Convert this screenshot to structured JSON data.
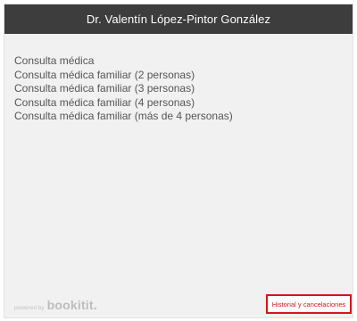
{
  "header": {
    "title": "Dr. Valentín López-Pintor González"
  },
  "services": [
    {
      "label": "Consulta médica"
    },
    {
      "label": "Consulta médica familiar (2 personas)"
    },
    {
      "label": "Consulta médica familiar (3 personas)"
    },
    {
      "label": "Consulta médica familiar (4 personas)"
    },
    {
      "label": "Consulta médica familiar (más de 4 personas)"
    }
  ],
  "footer": {
    "powered_by": "powered by",
    "brand": "bookitit",
    "brand_suffix": ".",
    "history_link": "Historial y cancelaciones"
  },
  "colors": {
    "header_bg": "#3d3d3d",
    "panel_bg": "#f1f1f1",
    "link_accent": "#d7141a"
  }
}
